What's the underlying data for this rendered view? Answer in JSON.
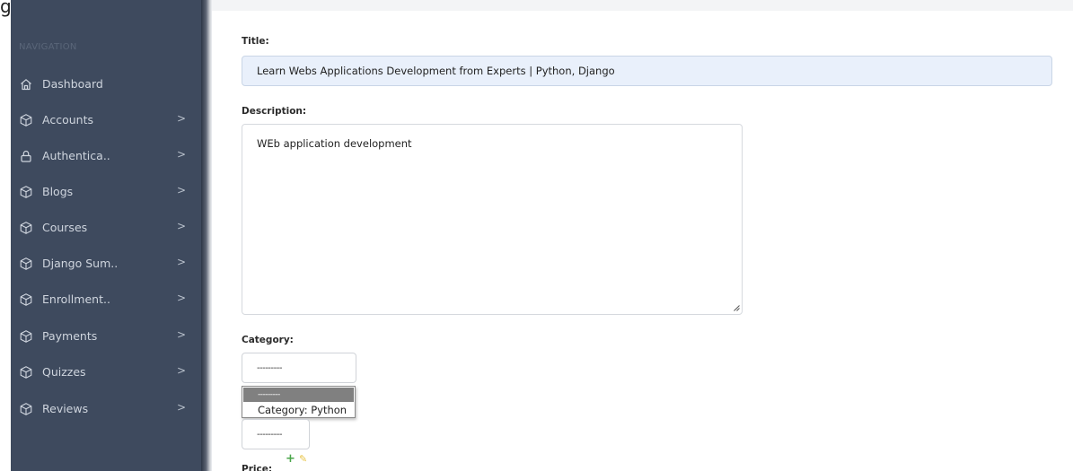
{
  "top_fragment": "g",
  "sidebar": {
    "heading": "NAVIGATION",
    "items": [
      {
        "label": "Dashboard",
        "icon": "home-icon",
        "has_chevron": false
      },
      {
        "label": "Accounts",
        "icon": "box-icon",
        "has_chevron": true
      },
      {
        "label": "Authentica..",
        "icon": "lock-icon",
        "has_chevron": true
      },
      {
        "label": "Blogs",
        "icon": "box-icon",
        "has_chevron": true
      },
      {
        "label": "Courses",
        "icon": "box-icon",
        "has_chevron": true
      },
      {
        "label": "Django Sum..",
        "icon": "box-icon",
        "has_chevron": true
      },
      {
        "label": "Enrollment..",
        "icon": "box-icon",
        "has_chevron": true
      },
      {
        "label": "Payments",
        "icon": "box-icon",
        "has_chevron": true
      },
      {
        "label": "Quizzes",
        "icon": "box-icon",
        "has_chevron": true
      },
      {
        "label": "Reviews",
        "icon": "box-icon",
        "has_chevron": true
      }
    ],
    "chevron": ">"
  },
  "form": {
    "title_label": "Title:",
    "title_value": "Learn Webs Applications Development from Experts | Python, Django",
    "description_label": "Description:",
    "description_value": "WEb application development",
    "category_label": "Category:",
    "category_selected": "---------",
    "category_options": [
      "---------",
      "Category: Python"
    ],
    "second_select_value": "---------",
    "price_label": "Price:"
  },
  "colors": {
    "sidebar_bg": "#3e4a5e",
    "title_input_bg": "#e9f0fb",
    "add_icon": "#4aa64a",
    "edit_icon": "#e8c448"
  }
}
